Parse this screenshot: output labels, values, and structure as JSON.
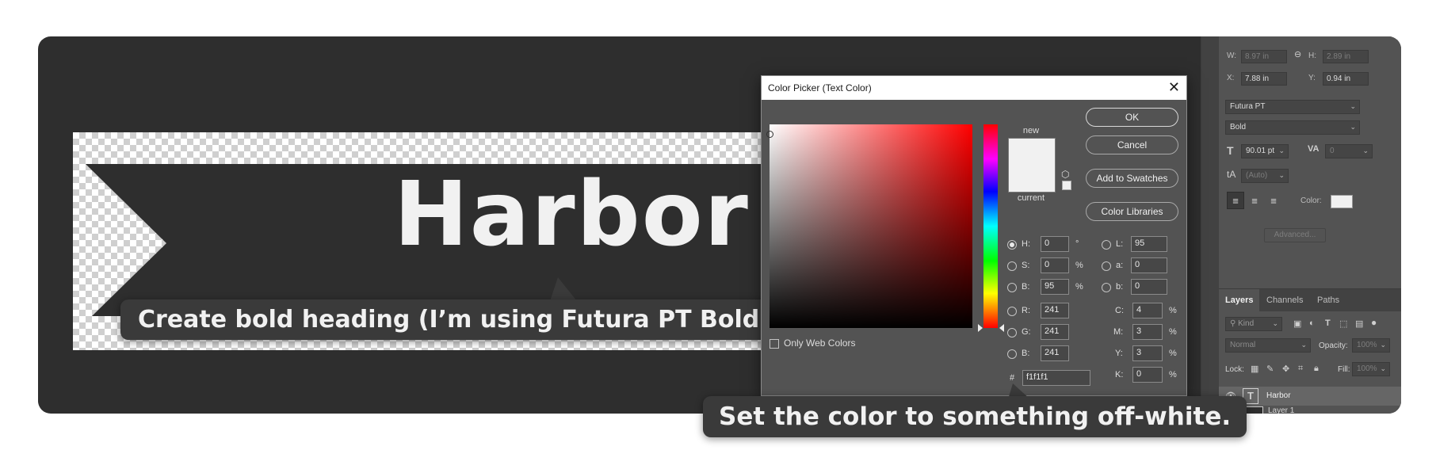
{
  "canvas": {
    "heading_text": "Harbor",
    "text_color": "#f1f1f1",
    "banner_color": "#2e2e2e"
  },
  "callouts": {
    "step_heading": "Create bold heading (I’m using Futura PT Bold).",
    "step_color": "Set the color to something off-white."
  },
  "properties": {
    "w_label": "W:",
    "w_value": "8.97 in",
    "h_label": "H:",
    "h_value": "2.89 in",
    "x_label": "X:",
    "x_value": "7.88 in",
    "y_label": "Y:",
    "y_value": "0.94 in",
    "font_family": "Futura PT",
    "font_style": "Bold",
    "font_size": "90.01 pt",
    "tracking": "0",
    "leading": "(Auto)",
    "color_label": "Color:",
    "color_value": "#f1f1f1",
    "advanced_label": "Advanced..."
  },
  "layers_panel": {
    "tabs": [
      "Layers",
      "Channels",
      "Paths"
    ],
    "filter_kind": "Kind",
    "blend_mode": "Normal",
    "opacity_label": "Opacity:",
    "opacity_value": "100%",
    "lock_label": "Lock:",
    "fill_label": "Fill:",
    "fill_value": "100%",
    "layers": [
      "Harbor",
      "Layer 1"
    ]
  },
  "color_picker": {
    "title": "Color Picker (Text Color)",
    "buttons": {
      "ok": "OK",
      "cancel": "Cancel",
      "add_swatches": "Add to Swatches",
      "libraries": "Color Libraries"
    },
    "label_new": "new",
    "label_current": "current",
    "new_color": "#f1f1f1",
    "current_color": "#f1f1f1",
    "only_web_colors": "Only Web Colors",
    "hsb": {
      "h": {
        "label": "H:",
        "value": "0",
        "unit": "°"
      },
      "s": {
        "label": "S:",
        "value": "0",
        "unit": "%"
      },
      "b": {
        "label": "B:",
        "value": "95",
        "unit": "%"
      }
    },
    "rgb": {
      "r": {
        "label": "R:",
        "value": "241"
      },
      "g": {
        "label": "G:",
        "value": "241"
      },
      "b": {
        "label": "B:",
        "value": "241"
      }
    },
    "lab": {
      "l": {
        "label": "L:",
        "value": "95"
      },
      "a": {
        "label": "a:",
        "value": "0"
      },
      "b": {
        "label": "b:",
        "value": "0"
      }
    },
    "cmyk": {
      "c": {
        "label": "C:",
        "value": "4",
        "unit": "%"
      },
      "m": {
        "label": "M:",
        "value": "3",
        "unit": "%"
      },
      "y": {
        "label": "Y:",
        "value": "3",
        "unit": "%"
      },
      "k": {
        "label": "K:",
        "value": "0",
        "unit": "%"
      }
    },
    "hex_label": "#",
    "hex_value": "f1f1f1",
    "selected_mode": "H"
  }
}
